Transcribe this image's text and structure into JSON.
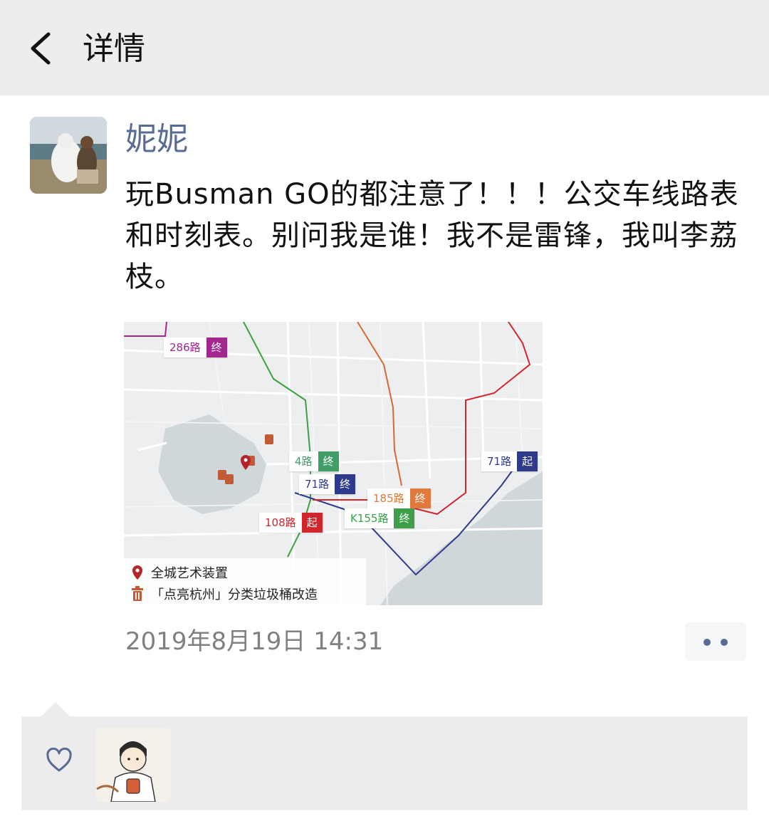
{
  "header": {
    "title": "详情",
    "back_icon": "chevron-left-icon"
  },
  "post": {
    "author": "妮妮",
    "text": "玩Busman GO的都注意了！！！公交车线路表和时刻表。别问我是谁！我不是雷锋，我叫李荔枝。",
    "timestamp": "2019年8月19日 14:31",
    "image": {
      "routes": [
        {
          "num": "286路",
          "tag": "终",
          "color": "#a3278f"
        },
        {
          "num": "4路",
          "tag": "终",
          "color": "#3f9f66"
        },
        {
          "num": "71路",
          "tag": "终",
          "color": "#2e3a8c"
        },
        {
          "num": "71路",
          "tag": "起",
          "color": "#2e3a8c"
        },
        {
          "num": "185路",
          "tag": "终",
          "color": "#e07a3c"
        },
        {
          "num": "108路",
          "tag": "起",
          "color": "#d0262e"
        },
        {
          "num": "K155路",
          "tag": "终",
          "color": "#3d9f49"
        }
      ],
      "legend": [
        {
          "icon": "map-pin-icon",
          "text": "全城艺术装置"
        },
        {
          "icon": "trash-bin-icon",
          "text": "「点亮杭州」分类垃圾桶改造"
        }
      ]
    }
  },
  "actions": {
    "more_icon": "more-dots-icon"
  },
  "likes": {
    "icon": "heart-icon"
  },
  "colors": {
    "link": "#576b95",
    "topbar_bg": "#ededed",
    "likes_bg": "#ececec"
  }
}
